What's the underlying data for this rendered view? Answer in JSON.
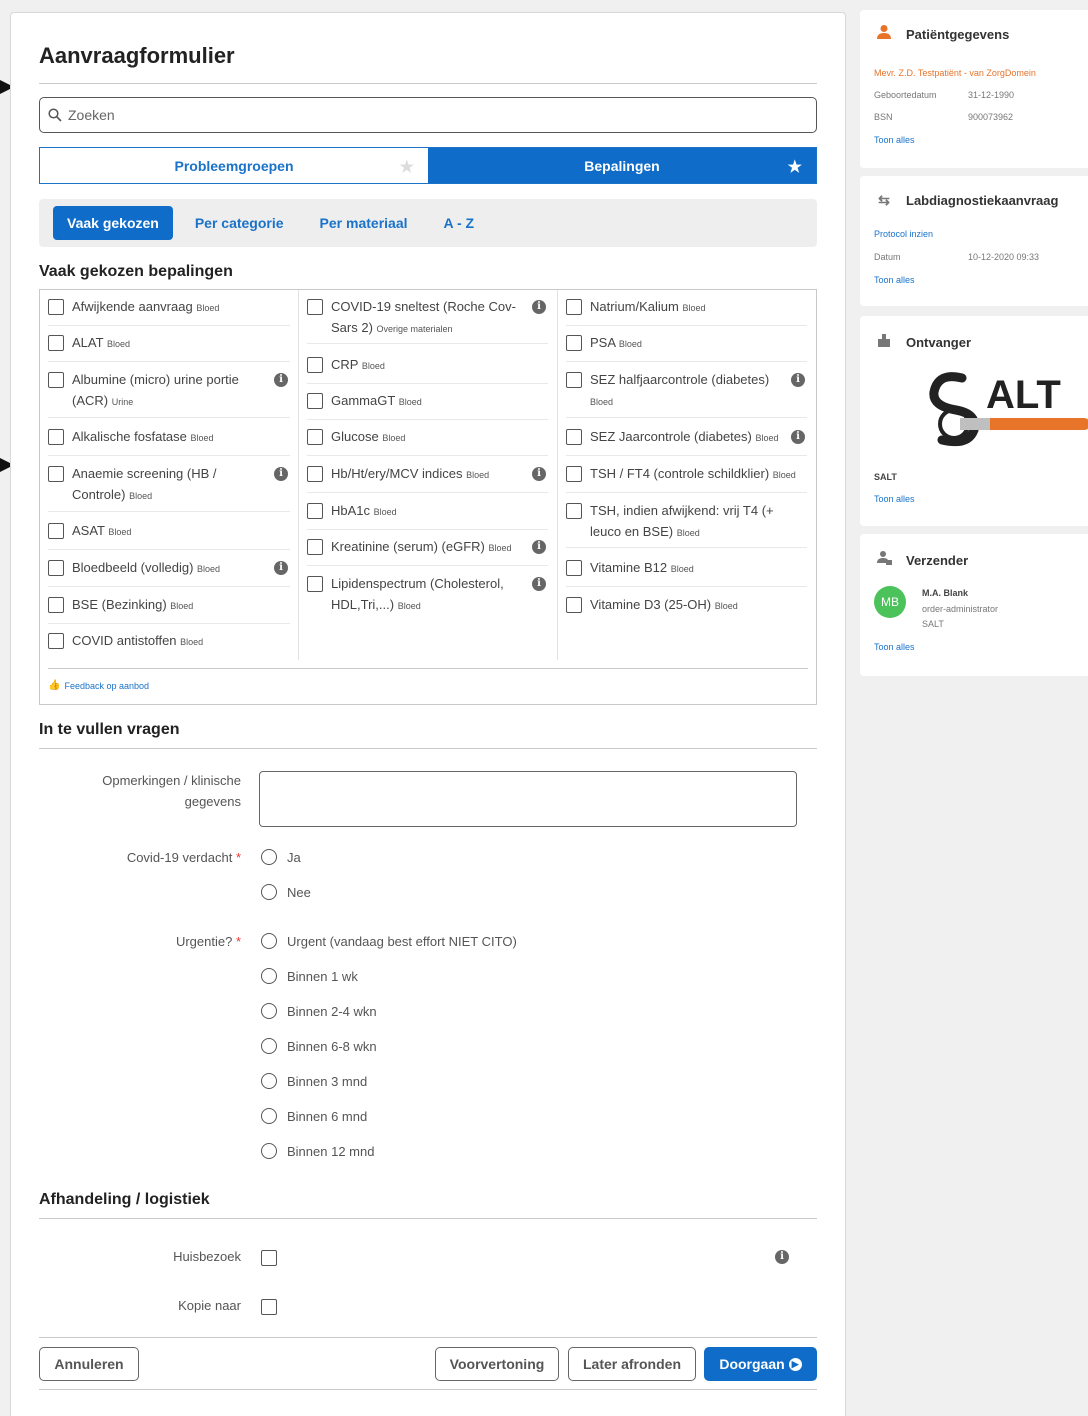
{
  "form": {
    "title": "Aanvraagformulier",
    "search_placeholder": "Zoeken",
    "tabs": [
      {
        "label": "Probleemgroepen",
        "active": false
      },
      {
        "label": "Bepalingen",
        "active": true
      }
    ],
    "subnav": [
      {
        "label": "Vaak gekozen",
        "selected": true
      },
      {
        "label": "Per categorie",
        "selected": false
      },
      {
        "label": "Per materiaal",
        "selected": false
      },
      {
        "label": "A - Z",
        "selected": false
      }
    ],
    "section_common": "Vaak gekozen bepalingen",
    "tests": {
      "col1": [
        {
          "label": "Afwijkende aanvraag",
          "tag": "Bloed",
          "info": false
        },
        {
          "label": "ALAT",
          "tag": "Bloed",
          "info": false
        },
        {
          "label": "Albumine (micro) urine portie (ACR)",
          "tag": "Urine",
          "info": true
        },
        {
          "label": "Alkalische fosfatase",
          "tag": "Bloed",
          "info": false
        },
        {
          "label": "Anaemie screening (HB / Controle)",
          "tag": "Bloed",
          "info": true
        },
        {
          "label": "ASAT",
          "tag": "Bloed",
          "info": false
        },
        {
          "label": "Bloedbeeld (volledig)",
          "tag": "Bloed",
          "info": true
        },
        {
          "label": "BSE (Bezinking)",
          "tag": "Bloed",
          "info": false
        },
        {
          "label": "COVID antistoffen",
          "tag": "Bloed",
          "info": false
        }
      ],
      "col2": [
        {
          "label": "COVID-19 sneltest (Roche Cov-Sars 2)",
          "tag": "Overige materialen",
          "info": true
        },
        {
          "label": "CRP",
          "tag": "Bloed",
          "info": false
        },
        {
          "label": "GammaGT",
          "tag": "Bloed",
          "info": false
        },
        {
          "label": "Glucose",
          "tag": "Bloed",
          "info": false
        },
        {
          "label": "Hb/Ht/ery/MCV indices",
          "tag": "Bloed",
          "info": true
        },
        {
          "label": "HbA1c",
          "tag": "Bloed",
          "info": false
        },
        {
          "label": "Kreatinine (serum) (eGFR)",
          "tag": "Bloed",
          "info": true
        },
        {
          "label": "Lipidenspectrum (Cholesterol, HDL,Tri,...)",
          "tag": "Bloed",
          "info": true
        }
      ],
      "col3": [
        {
          "label": "Natrium/Kalium",
          "tag": "Bloed",
          "info": false
        },
        {
          "label": "PSA",
          "tag": "Bloed",
          "info": false
        },
        {
          "label": "SEZ halfjaarcontrole (diabetes)",
          "tag": "Bloed",
          "info": true
        },
        {
          "label": "SEZ Jaarcontrole (diabetes)",
          "tag": "Bloed",
          "info": true
        },
        {
          "label": "TSH / FT4 (controle schildklier)",
          "tag": "Bloed",
          "info": false
        },
        {
          "label": "TSH, indien afwijkend: vrij T4 (+ leuco en BSE)",
          "tag": "Bloed",
          "info": false
        },
        {
          "label": "Vitamine B12",
          "tag": "Bloed",
          "info": false
        },
        {
          "label": "Vitamine D3 (25-OH)",
          "tag": "Bloed",
          "info": false
        }
      ]
    },
    "feedback_label": "Feedback op aanbod",
    "section_questions": "In te vullen vragen",
    "remarks_label": "Opmerkingen / klinische gegevens",
    "covid_label": "Covid-19 verdacht",
    "covid_options": [
      "Ja",
      "Nee"
    ],
    "urgency_label": "Urgentie?",
    "urgency_options": [
      "Urgent (vandaag best effort NIET CITO)",
      "Binnen 1 wk",
      "Binnen 2-4 wkn",
      "Binnen 6-8 wkn",
      "Binnen 3 mnd",
      "Binnen 6 mnd",
      "Binnen 12 mnd"
    ],
    "required_mark": "*",
    "section_logistics": "Afhandeling / logistiek",
    "home_visit_label": "Huisbezoek",
    "copy_to_label": "Kopie naar",
    "buttons": {
      "cancel": "Annuleren",
      "preview": "Voorvertoning",
      "later": "Later afronden",
      "continue": "Doorgaan"
    }
  },
  "sidebar": {
    "patient": {
      "title": "Patiëntgegevens",
      "name": "Mevr. Z.D. Testpatiënt - van ZorgDomein",
      "dob_label": "Geboortedatum",
      "dob_value": "31-12-1990",
      "bsn_label": "BSN",
      "bsn_value": "900073962",
      "link": "Toon alles"
    },
    "lab": {
      "title": "Labdiagnostiekaanvraag",
      "protocol_link": "Protocol inzien",
      "date_label": "Datum",
      "date_value": "10-12-2020 09:33",
      "link": "Toon alles"
    },
    "receiver": {
      "title": "Ontvanger",
      "logo_text": "ALT",
      "name": "SALT",
      "link": "Toon alles"
    },
    "sender": {
      "title": "Verzender",
      "initials": "MB",
      "name": "M.A. Blank",
      "role": "order-administrator",
      "org": "SALT",
      "link": "Toon alles"
    }
  },
  "colors": {
    "primary": "#0f6cc8",
    "accent_orange": "#e8742a",
    "avatar_green": "#4cc25a"
  }
}
